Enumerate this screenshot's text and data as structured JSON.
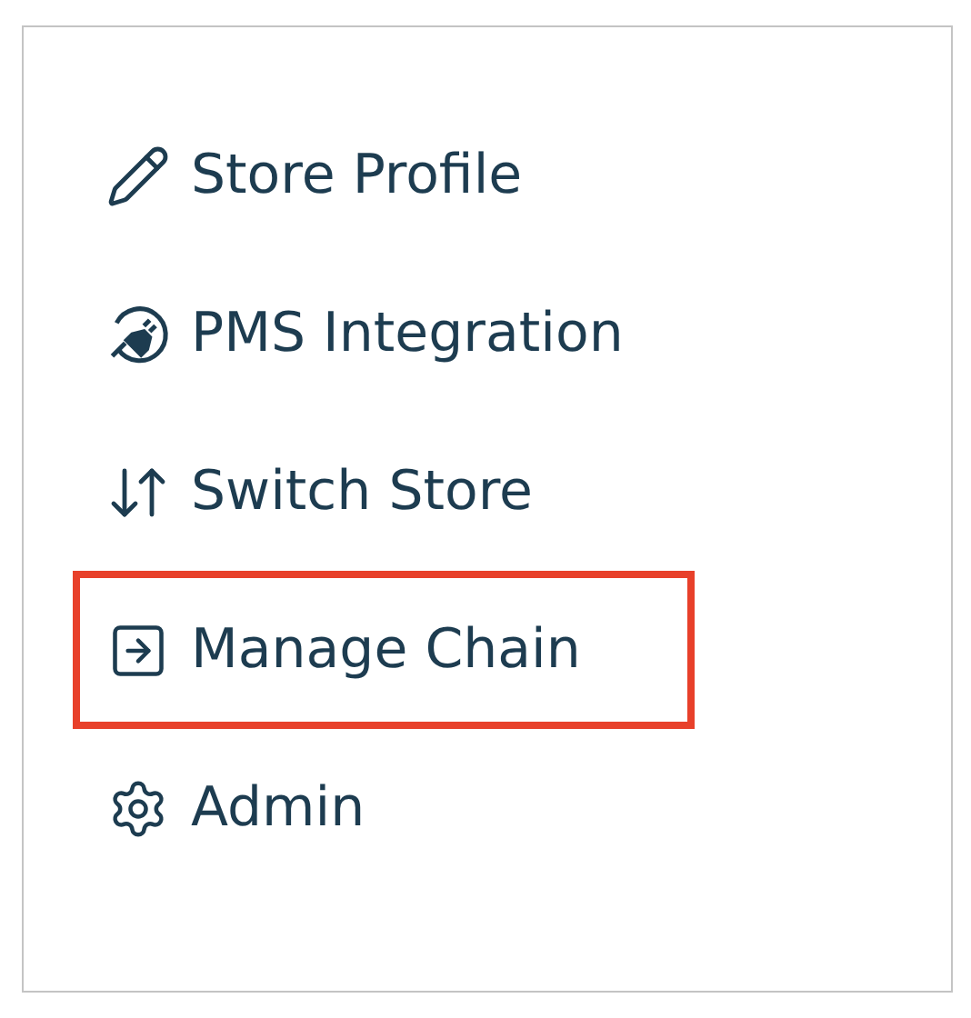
{
  "menu": {
    "items": [
      {
        "kind": "edit",
        "label": "Store Profile",
        "highlighted": false
      },
      {
        "kind": "plug",
        "label": "PMS Integration",
        "highlighted": false
      },
      {
        "kind": "swap",
        "label": "Switch Store",
        "highlighted": false
      },
      {
        "kind": "enter",
        "label": "Manage Chain",
        "highlighted": true
      },
      {
        "kind": "settings",
        "label": "Admin",
        "highlighted": false
      }
    ]
  }
}
